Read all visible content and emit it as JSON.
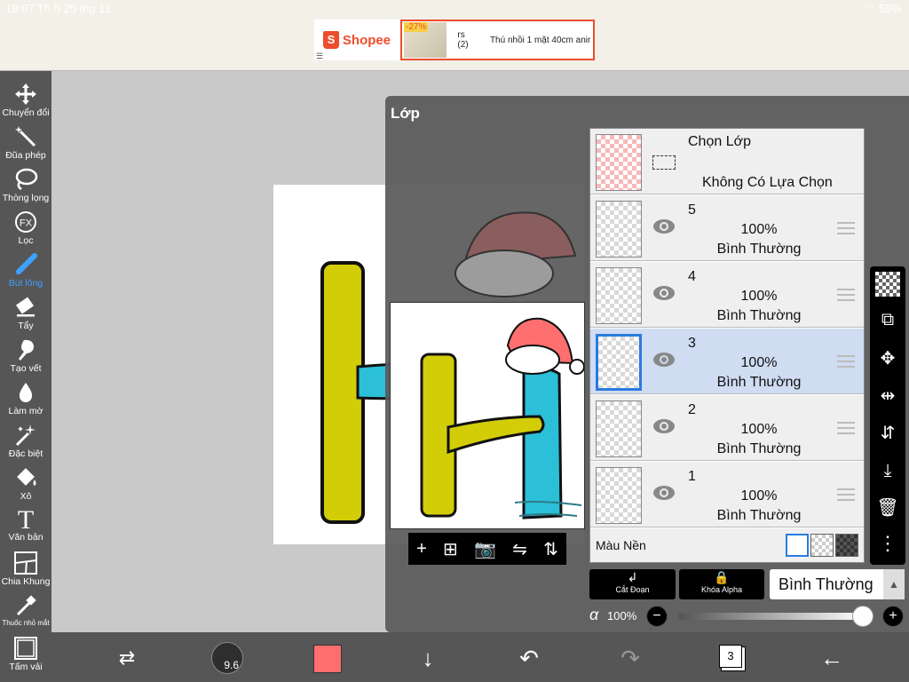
{
  "status": {
    "time": "19:07",
    "date": "Th 5 25 thg 11",
    "battery": "59%"
  },
  "ad": {
    "brand": "Shopee",
    "discount": "-27%",
    "text1": "rs (2)",
    "text2": "Thú nhồi 1 mặt 40cm anir"
  },
  "tools": [
    {
      "label": "Chuyển đổi"
    },
    {
      "label": "Đũa phép"
    },
    {
      "label": "Thòng lọng"
    },
    {
      "label": "Lọc",
      "icon_text": "FX"
    },
    {
      "label": "Bút lông"
    },
    {
      "label": "Tẩy"
    },
    {
      "label": "Tạo vết"
    },
    {
      "label": "Làm mờ"
    },
    {
      "label": "Đặc biệt"
    },
    {
      "label": "Xô"
    },
    {
      "label": "Văn bản",
      "icon_text": "T"
    },
    {
      "label": "Chia Khung"
    },
    {
      "label": "Thuốc nhỏ mắt"
    },
    {
      "label": "Tấm vải"
    }
  ],
  "active_tool": "Bút lông",
  "panel": {
    "title": "Lớp",
    "selection": {
      "title": "Chọn Lớp",
      "subtitle": "Không Có Lựa Chọn"
    },
    "layers": [
      {
        "num": "5",
        "opacity": "100%",
        "mode": "Bình Thường",
        "selected": false
      },
      {
        "num": "4",
        "opacity": "100%",
        "mode": "Bình Thường",
        "selected": false
      },
      {
        "num": "3",
        "opacity": "100%",
        "mode": "Bình Thường",
        "selected": true
      },
      {
        "num": "2",
        "opacity": "100%",
        "mode": "Bình Thường",
        "selected": false
      },
      {
        "num": "1",
        "opacity": "100%",
        "mode": "Bình Thường",
        "selected": false
      }
    ],
    "background_label": "Màu Nền",
    "clip_label": "Cắt Đoạn",
    "alpha_lock_label": "Khóa Alpha",
    "blend_mode": "Bình Thường",
    "alpha_symbol": "α",
    "opacity": "100%",
    "opacity_fraction": 1.0
  },
  "bottom": {
    "brush_size": "9.6",
    "layer_count": "3",
    "color": "#ff6f6f"
  },
  "colors": {
    "accent": "#3ea2ff",
    "toolbar": "#565656",
    "selected_layer": "#cfdcf2"
  }
}
